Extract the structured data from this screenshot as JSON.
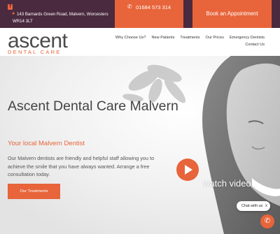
{
  "topbar": {
    "facebook_icon": "facebook-icon",
    "address_line1": "143 Barnards Green Road, Malvern, Worcesters",
    "address_line2": "WR14 3LT",
    "phone": "01684 573 314",
    "book_label": "Book an Appointment",
    "accent": "#e8643a",
    "bg": "#4a2a3f"
  },
  "logo": {
    "word": "scent",
    "first_letter": "a",
    "subtitle": "DENTAL CARE"
  },
  "nav": {
    "items": [
      "Why Choose Us?",
      "New Patients",
      "Treatments",
      "Our Prices",
      "Emergency Dentists"
    ],
    "contact": "Contact Us"
  },
  "hero": {
    "title": "Ascent Dental Care Malvern",
    "subtitle": "Your local Malvern Dentist",
    "paragraph": "Our Malvern dentists are friendly and helpful staff allowing you to achieve the smile that you have always wanted. Arrange a free consultation today.",
    "cta": "Our Treatments",
    "watch_label": "watch video"
  },
  "chat": {
    "label": "Chat with us",
    "close": "x"
  }
}
